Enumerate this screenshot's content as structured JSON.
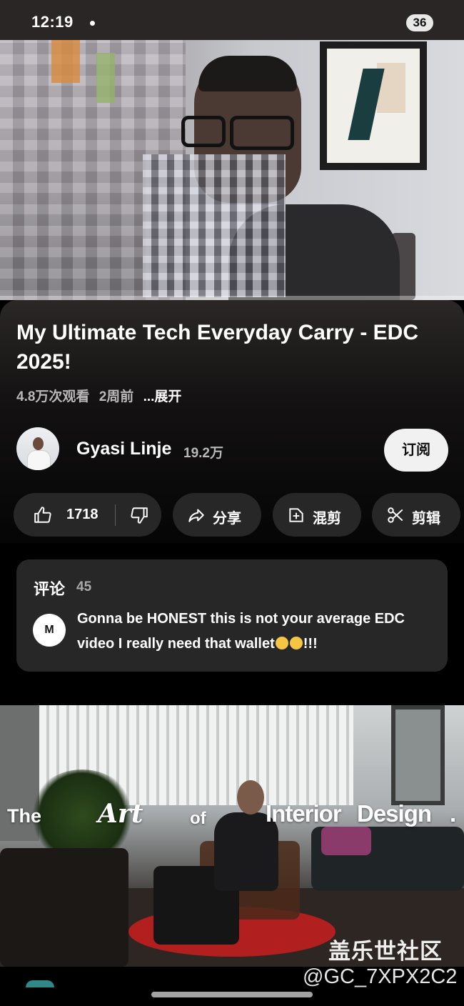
{
  "status_bar": {
    "time": "12:19",
    "battery": "36"
  },
  "video": {
    "title": "My Ultimate Tech Everyday Carry - EDC 2025!",
    "views": "4.8万次观看",
    "age": "2周前",
    "expand_label": "...展开"
  },
  "channel": {
    "name": "Gyasi Linje",
    "subscribers": "19.2万",
    "subscribe_label": "订阅"
  },
  "actions": {
    "like_count": "1718",
    "share_label": "分享",
    "remix_label": "混剪",
    "clip_label": "剪辑"
  },
  "comments": {
    "title": "评论",
    "count": "45",
    "commenter_initials": "M",
    "top_comment_text": "Gonna be HONEST this is not your average EDC video I really need that wallet",
    "top_comment_suffix": "!!!"
  },
  "next_video": {
    "overlay_words": [
      "The",
      "Art",
      "of",
      "Interior",
      "Design",
      "."
    ]
  },
  "watermark": {
    "site": "盖乐世社区",
    "user_id": "@GC_7XPX2C2"
  },
  "colors": {
    "background": "#000000",
    "card": "#272727",
    "subscribe_bg": "#f1f1f1",
    "secondary_text": "#b9b9b9"
  }
}
